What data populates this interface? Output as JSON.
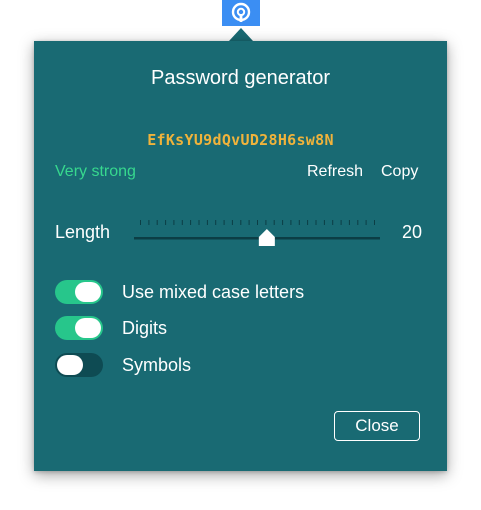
{
  "popup": {
    "title": "Password generator",
    "password": "EfKsYU9dQvUD28H6sw8N",
    "strength": "Very strong",
    "refresh_label": "Refresh",
    "copy_label": "Copy",
    "length_label": "Length",
    "length_value": "20",
    "length_slider_fraction": 0.54,
    "options": [
      {
        "label": "Use mixed case letters",
        "enabled": true
      },
      {
        "label": "Digits",
        "enabled": true
      },
      {
        "label": "Symbols",
        "enabled": false
      }
    ],
    "close_label": "Close"
  },
  "colors": {
    "panel_bg": "#196a73",
    "password": "#f0b33b",
    "strength": "#37d88e",
    "toggle_on": "#27c68b",
    "toggle_off": "#0e4b53",
    "anchor_button": "#3b8ef3"
  },
  "icons": {
    "anchor": "password-generator-icon"
  }
}
